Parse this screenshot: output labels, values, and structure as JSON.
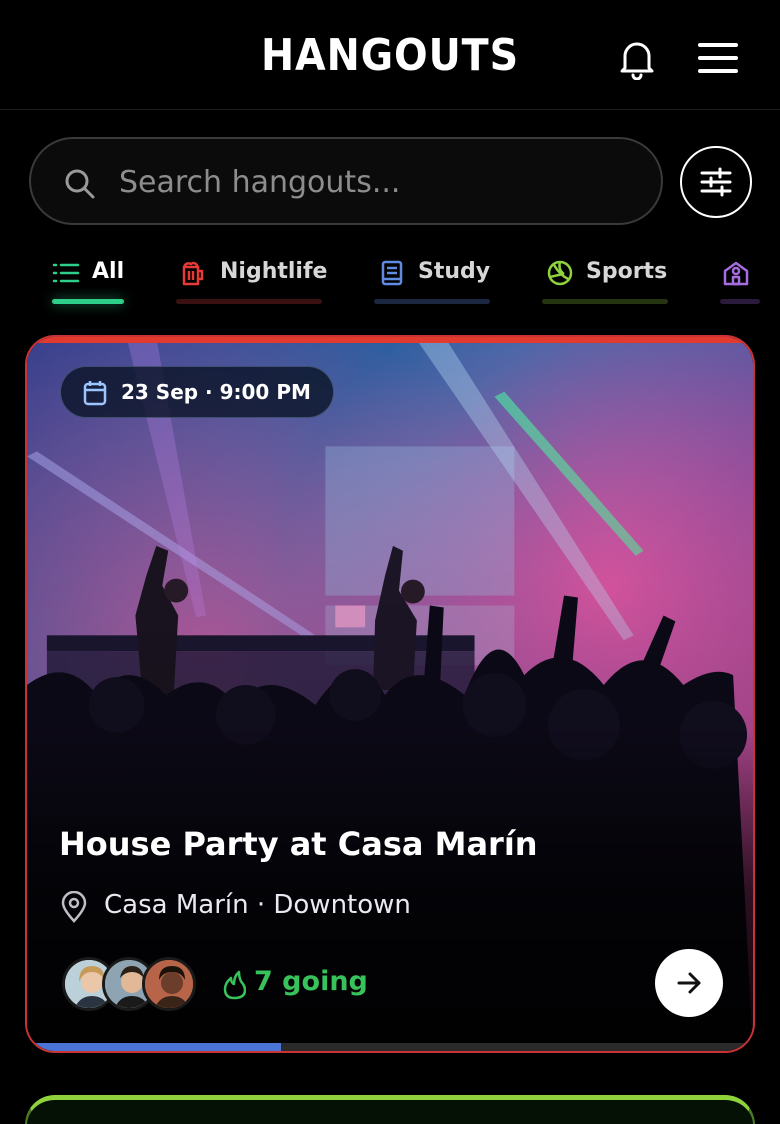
{
  "header": {
    "title": "HANGOUTS",
    "bell_icon": "bell-icon",
    "menu_icon": "hamburger-menu-icon"
  },
  "search": {
    "placeholder": "Search hangouts...",
    "value": "",
    "icon": "search-icon",
    "filter_icon": "sliders-icon"
  },
  "tabs": [
    {
      "label": "All",
      "icon": "list-icon",
      "color": "#2ecf8a",
      "active": true
    },
    {
      "label": "Nightlife",
      "icon": "beer-mug-icon",
      "color": "#e53a35",
      "active": false
    },
    {
      "label": "Study",
      "icon": "book-icon",
      "color": "#5e8ae0",
      "active": false
    },
    {
      "label": "Sports",
      "icon": "volleyball-icon",
      "color": "#8fd23c",
      "active": false
    },
    {
      "label": "",
      "icon": "school-building-icon",
      "color": "#a66ce0",
      "active": false
    }
  ],
  "event": {
    "date": "23 Sep · 9:00 PM",
    "title": "House Party at Casa Marín",
    "location": "Casa Marín · Downtown",
    "going": "7 going",
    "accent": "#e23a2e",
    "progress": 0.35,
    "progress_color": "#4a74d6",
    "going_color": "#37c25c"
  },
  "next_card": {
    "accent": "#8fd23c"
  }
}
